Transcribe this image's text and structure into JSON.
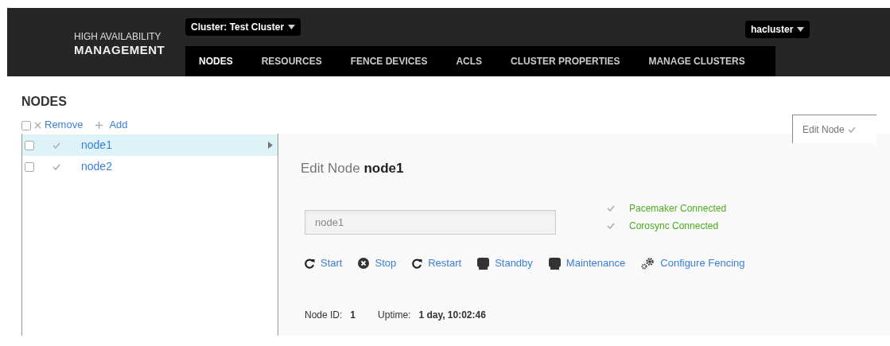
{
  "header": {
    "brand_top": "HIGH AVAILABILITY",
    "brand_bottom": "MANAGEMENT",
    "cluster_menu": "Cluster: Test Cluster",
    "user_menu": "hacluster"
  },
  "nav": [
    {
      "label": "NODES",
      "selected": true
    },
    {
      "label": "RESOURCES",
      "selected": false
    },
    {
      "label": "FENCE DEVICES",
      "selected": false
    },
    {
      "label": "ACLS",
      "selected": false
    },
    {
      "label": "CLUSTER PROPERTIES",
      "selected": false
    },
    {
      "label": "MANAGE CLUSTERS",
      "selected": false
    }
  ],
  "page_title": "NODES",
  "toolbar": {
    "select_all_checked": false,
    "remove": "Remove",
    "add": "Add"
  },
  "nodes": [
    {
      "name": "node1",
      "checked": false,
      "selected": true
    },
    {
      "name": "node2",
      "checked": false,
      "selected": false
    }
  ],
  "side_tab": {
    "label": "Edit Node"
  },
  "detail": {
    "title": "Edit Node **node1**",
    "name_field": {
      "placeholder": "node1"
    },
    "status": [
      {
        "label": "Pacemaker Connected"
      },
      {
        "label": "Corosync Connected"
      }
    ],
    "actions": [
      {
        "kind": "refresh",
        "label": "Start"
      },
      {
        "kind": "stop",
        "label": "Stop"
      },
      {
        "kind": "refresh",
        "label": "Restart"
      },
      {
        "kind": "server",
        "label": "Standby"
      },
      {
        "kind": "server",
        "label": "Maintenance"
      },
      {
        "kind": "gears",
        "label": "Configure Fencing"
      }
    ],
    "info": [
      {
        "label": "Node ID:",
        "value": "1"
      },
      {
        "label": "Uptime:",
        "value": "1 day, 10:02:46"
      }
    ]
  }
}
